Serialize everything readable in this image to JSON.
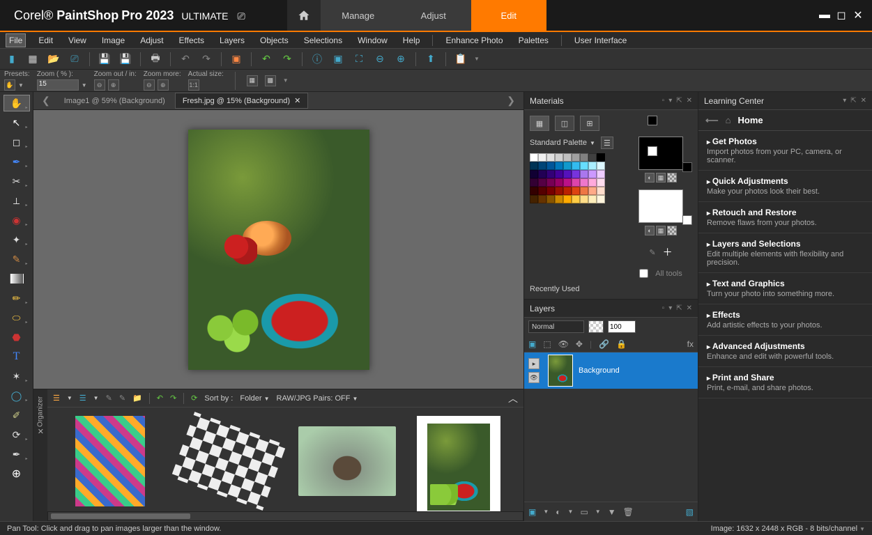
{
  "app": {
    "brand": "Corel®",
    "name1": "PaintShop",
    "name2": "Pro 2023",
    "edition": "ULTIMATE"
  },
  "workspace_tabs": {
    "manage": "Manage",
    "adjust": "Adjust",
    "edit": "Edit"
  },
  "menu": [
    "File",
    "Edit",
    "View",
    "Image",
    "Adjust",
    "Effects",
    "Layers",
    "Objects",
    "Selections",
    "Window",
    "Help",
    "Enhance Photo",
    "Palettes",
    "User Interface"
  ],
  "options": {
    "presets_label": "Presets:",
    "zoom_label": "Zoom ( % ):",
    "zoom_value": "15",
    "zoomio_label": "Zoom out / in:",
    "zoommore_label": "Zoom more:",
    "actual_label": "Actual size:"
  },
  "doc_tabs": {
    "t1": "Image1 @   59% (Background)",
    "t2": "Fresh.jpg @   15% (Background)"
  },
  "materials": {
    "title": "Materials",
    "palette": "Standard Palette",
    "all_tools": "All tools",
    "recently": "Recently Used"
  },
  "layers": {
    "title": "Layers",
    "blend": "Normal",
    "opacity": "100",
    "bg": "Background"
  },
  "learning": {
    "title": "Learning Center",
    "home": "Home",
    "sections": [
      {
        "t": "Get Photos",
        "d": "Import photos from your PC, camera, or scanner."
      },
      {
        "t": "Quick Adjustments",
        "d": "Make your photos look their best."
      },
      {
        "t": "Retouch and Restore",
        "d": "Remove flaws from your photos."
      },
      {
        "t": "Layers and Selections",
        "d": "Edit multiple elements with flexibility and precision."
      },
      {
        "t": "Text and Graphics",
        "d": "Turn your photo into something more."
      },
      {
        "t": "Effects",
        "d": "Add artistic effects to your photos."
      },
      {
        "t": "Advanced Adjustments",
        "d": "Enhance and edit with powerful tools."
      },
      {
        "t": "Print and Share",
        "d": "Print, e-mail, and share photos."
      }
    ]
  },
  "organizer": {
    "label": "Organizer",
    "sortby": "Sort by :",
    "folder": "Folder",
    "rawjpg": "RAW/JPG Pairs: OFF"
  },
  "status": {
    "left": "Pan Tool: Click and drag to pan images larger than the window.",
    "right": "Image:   1632 x 2448 x RGB - 8 bits/channel"
  },
  "swatches": [
    "#ffffff",
    "#f0f0f0",
    "#e0e0e0",
    "#d0d0d0",
    "#c0c0c0",
    "#a0a0a0",
    "#808080",
    "#404040",
    "#000000",
    "#003355",
    "#004477",
    "#005599",
    "#0077bb",
    "#1199cc",
    "#33bbee",
    "#66ddff",
    "#aaeeff",
    "#ddf7ff",
    "#110033",
    "#220055",
    "#330077",
    "#440099",
    "#5511bb",
    "#7733dd",
    "#aa77ee",
    "#cc99ff",
    "#eeccff",
    "#330033",
    "#550044",
    "#770055",
    "#990066",
    "#bb1188",
    "#dd44aa",
    "#ee77cc",
    "#ffaadd",
    "#ffddee",
    "#330000",
    "#550000",
    "#770000",
    "#991100",
    "#bb2200",
    "#dd4411",
    "#ee7744",
    "#ffaa88",
    "#ffddcc",
    "#442200",
    "#663300",
    "#885500",
    "#cc8800",
    "#ffaa00",
    "#ffcc44",
    "#ffdd88",
    "#ffeebb",
    "#fff5dd"
  ]
}
